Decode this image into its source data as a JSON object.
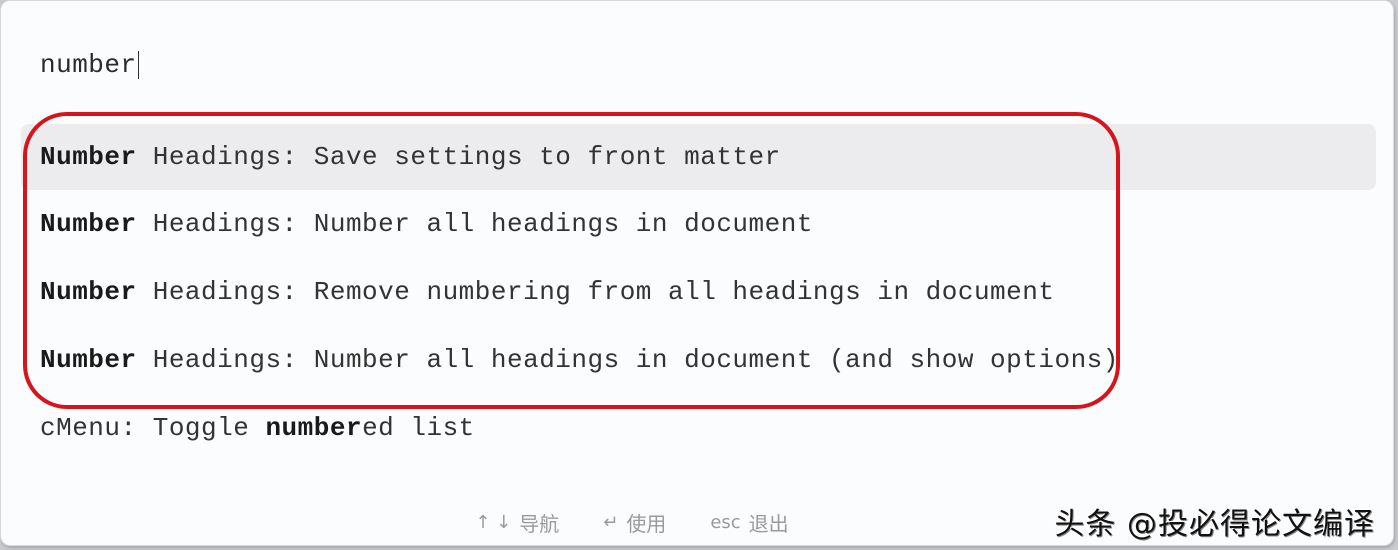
{
  "search": {
    "value": "number",
    "placeholder": ""
  },
  "results": [
    {
      "match": "Number",
      "rest": " Headings: Save settings to front matter",
      "selected": true
    },
    {
      "match": "Number",
      "rest": " Headings: Number all headings in document",
      "selected": false
    },
    {
      "match": "Number",
      "rest": " Headings: Remove numbering from all headings in document",
      "selected": false
    },
    {
      "match": "Number",
      "rest": " Headings: Number all headings in document (and show options)",
      "selected": false
    },
    {
      "prefix": "cMenu: Toggle ",
      "match": "number",
      "suffix": "ed list",
      "selected": false
    }
  ],
  "footer": {
    "nav": {
      "icon": "up-down-arrows-icon",
      "key": "↑ ↓",
      "label": "导航"
    },
    "use": {
      "icon": "enter-icon",
      "key": "↵",
      "label": "使用"
    },
    "exit": {
      "key": "esc",
      "label": "退出"
    }
  },
  "annotation": {
    "color": "#d6141b"
  },
  "watermark": "头条 @投必得论文编译"
}
